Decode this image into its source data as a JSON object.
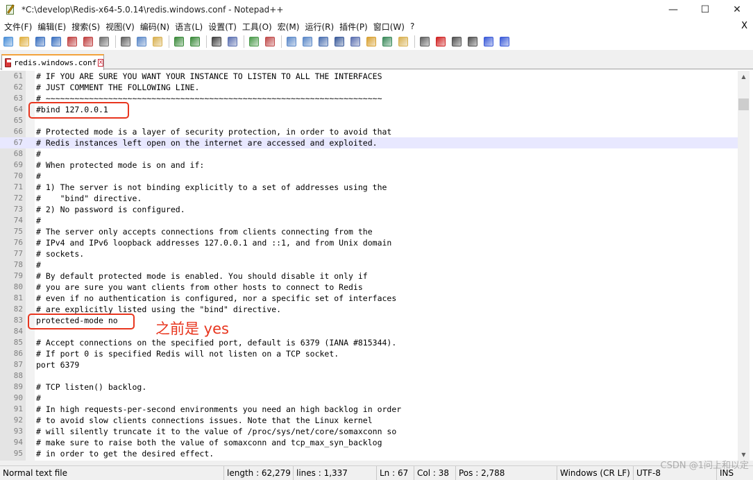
{
  "window": {
    "title": "*C:\\develop\\Redis-x64-5.0.14\\redis.windows.conf - Notepad++",
    "minimize": "—",
    "maximize": "☐",
    "close": "✕"
  },
  "menu": {
    "items": [
      "文件(F)",
      "编辑(E)",
      "搜索(S)",
      "视图(V)",
      "编码(N)",
      "语言(L)",
      "设置(T)",
      "工具(O)",
      "宏(M)",
      "运行(R)",
      "插件(P)",
      "窗口(W)",
      "?"
    ],
    "close_doc": "X"
  },
  "toolbar": {
    "icons": [
      "new-file",
      "open-file",
      "save",
      "save-all",
      "close",
      "close-all",
      "print",
      "cut",
      "copy",
      "paste",
      "undo",
      "redo",
      "find",
      "replace",
      "zoom-in",
      "zoom-out",
      "sync-vertical",
      "sync-horizontal",
      "word-wrap",
      "show-all-chars",
      "indent-guide",
      "document-map",
      "function-list",
      "folder-workspace",
      "monitor",
      "record-macro",
      "stop-record",
      "play-macro",
      "run-macro-multiple",
      "save-macro"
    ]
  },
  "tab": {
    "label": "redis.windows.conf",
    "close": "x"
  },
  "editor": {
    "current_line": 67,
    "lines": [
      {
        "n": "61",
        "t": "# IF YOU ARE SURE YOU WANT YOUR INSTANCE TO LISTEN TO ALL THE INTERFACES"
      },
      {
        "n": "62",
        "t": "# JUST COMMENT THE FOLLOWING LINE."
      },
      {
        "n": "63",
        "t": "# ~~~~~~~~~~~~~~~~~~~~~~~~~~~~~~~~~~~~~~~~~~~~~~~~~~~~~~~~~~~~~~~~~~~~~~"
      },
      {
        "n": "64",
        "t": "#bind 127.0.0.1"
      },
      {
        "n": "65",
        "t": ""
      },
      {
        "n": "66",
        "t": "# Protected mode is a layer of security protection, in order to avoid that"
      },
      {
        "n": "67",
        "t": "# Redis instances left open on the internet are accessed and exploited."
      },
      {
        "n": "68",
        "t": "#"
      },
      {
        "n": "69",
        "t": "# When protected mode is on and if:"
      },
      {
        "n": "70",
        "t": "#"
      },
      {
        "n": "71",
        "t": "# 1) The server is not binding explicitly to a set of addresses using the"
      },
      {
        "n": "72",
        "t": "#    \"bind\" directive."
      },
      {
        "n": "73",
        "t": "# 2) No password is configured."
      },
      {
        "n": "74",
        "t": "#"
      },
      {
        "n": "75",
        "t": "# The server only accepts connections from clients connecting from the"
      },
      {
        "n": "76",
        "t": "# IPv4 and IPv6 loopback addresses 127.0.0.1 and ::1, and from Unix domain"
      },
      {
        "n": "77",
        "t": "# sockets."
      },
      {
        "n": "78",
        "t": "#"
      },
      {
        "n": "79",
        "t": "# By default protected mode is enabled. You should disable it only if"
      },
      {
        "n": "80",
        "t": "# you are sure you want clients from other hosts to connect to Redis"
      },
      {
        "n": "81",
        "t": "# even if no authentication is configured, nor a specific set of interfaces"
      },
      {
        "n": "82",
        "t": "# are explicitly listed using the \"bind\" directive."
      },
      {
        "n": "83",
        "t": "protected-mode no"
      },
      {
        "n": "84",
        "t": ""
      },
      {
        "n": "85",
        "t": "# Accept connections on the specified port, default is 6379 (IANA #815344)."
      },
      {
        "n": "86",
        "t": "# If port 0 is specified Redis will not listen on a TCP socket."
      },
      {
        "n": "87",
        "t": "port 6379"
      },
      {
        "n": "88",
        "t": ""
      },
      {
        "n": "89",
        "t": "# TCP listen() backlog."
      },
      {
        "n": "90",
        "t": "#"
      },
      {
        "n": "91",
        "t": "# In high requests-per-second environments you need an high backlog in order"
      },
      {
        "n": "92",
        "t": "# to avoid slow clients connections issues. Note that the Linux kernel"
      },
      {
        "n": "93",
        "t": "# will silently truncate it to the value of /proc/sys/net/core/somaxconn so"
      },
      {
        "n": "94",
        "t": "# make sure to raise both the value of somaxconn and tcp_max_syn_backlog"
      },
      {
        "n": "95",
        "t": "# in order to get the desired effect."
      }
    ]
  },
  "annotation": {
    "text": "之前是 yes",
    "color": "#e8351e"
  },
  "statusbar": {
    "file_type": "Normal text file",
    "length": "length : 62,279",
    "lines": "lines : 1,337",
    "ln": "Ln : 67",
    "col": "Col : 38",
    "pos": "Pos : 2,788",
    "eol": "Windows (CR LF)",
    "encoding": "UTF-8",
    "mode": "INS"
  },
  "watermark": "CSDN @1问上和以定"
}
